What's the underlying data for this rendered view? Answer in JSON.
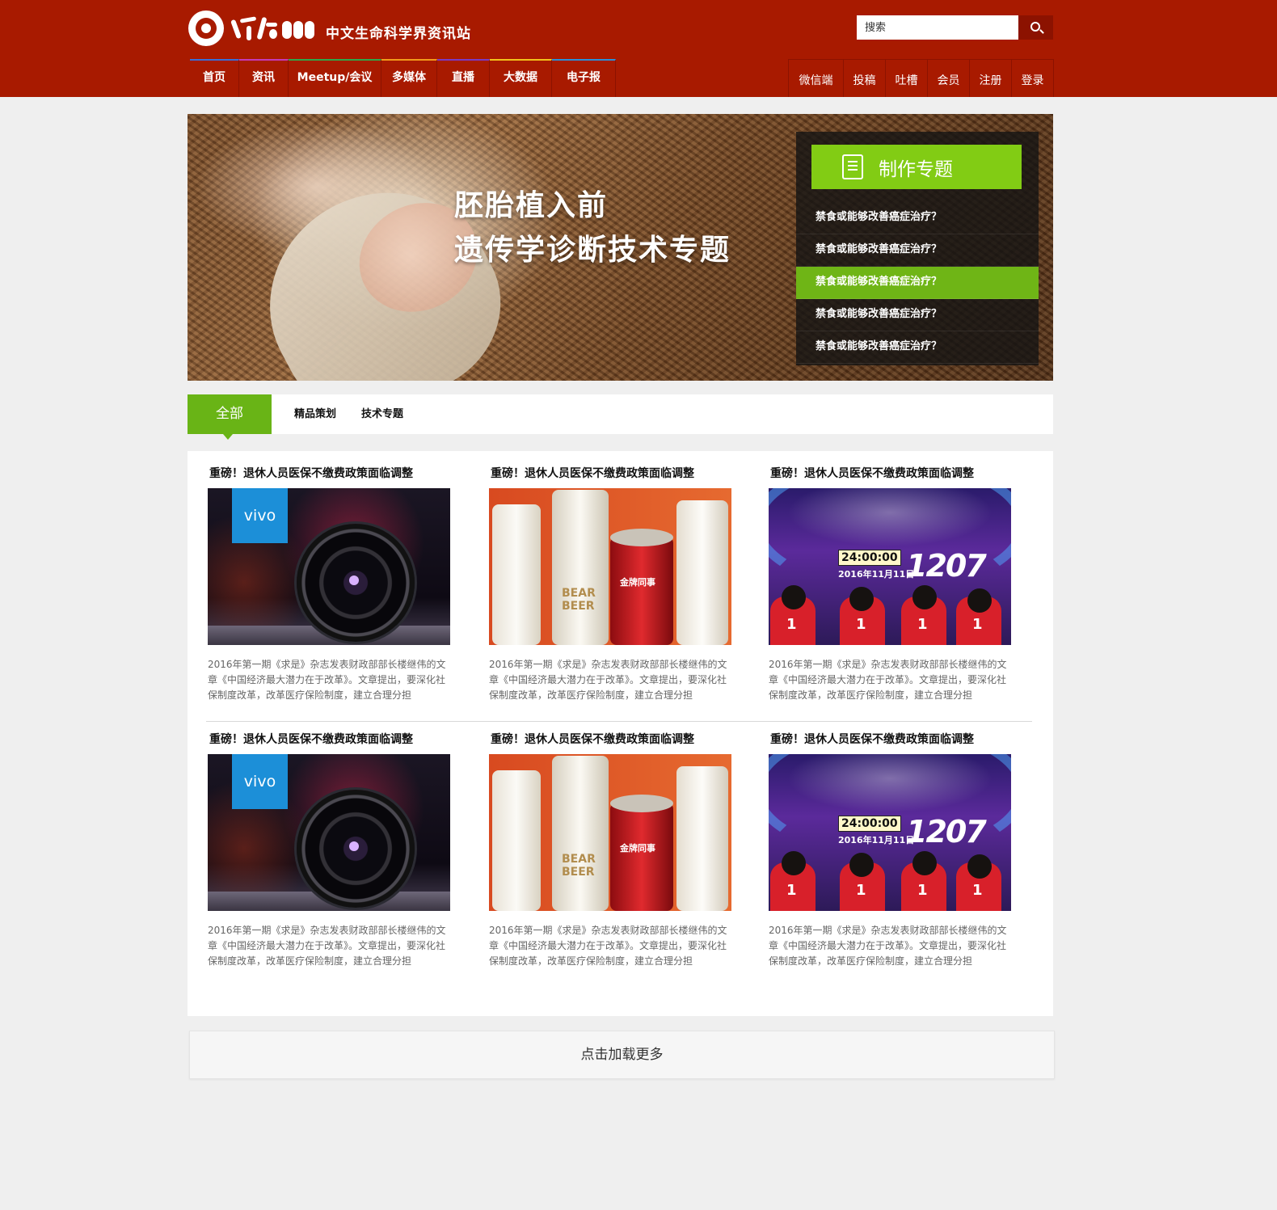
{
  "header": {
    "site_tagline": "中文生命科学界资讯站",
    "search": {
      "placeholder": "搜索"
    },
    "nav": [
      {
        "label": "首页",
        "accent": "#3a6fd8"
      },
      {
        "label": "资讯",
        "accent": "#c43ab8"
      },
      {
        "label": "Meetup/会议",
        "accent": "#2fa84a"
      },
      {
        "label": "多媒体",
        "accent": "#f29b1b"
      },
      {
        "label": "直播",
        "accent": "#7b3ac4"
      },
      {
        "label": "大数据",
        "accent": "#f2c21b"
      },
      {
        "label": "电子报",
        "accent": "#2b8fd8"
      }
    ],
    "subnav": [
      "微信端",
      "投稿",
      "吐槽",
      "会员",
      "注册",
      "登录"
    ]
  },
  "banner": {
    "title_line1": "胚胎植入前",
    "title_line2": "遗传学诊断技术专题",
    "panel_heading": "制作专题",
    "topics": [
      "禁食或能够改善癌症治疗？",
      "禁食或能够改善癌症治疗？",
      "禁食或能够改善癌症治疗？",
      "禁食或能够改善癌症治疗？",
      "禁食或能够改善癌症治疗？"
    ],
    "active_topic_index": 2
  },
  "tabs": [
    "全部",
    "精品策划",
    "技术专题"
  ],
  "images": {
    "camera": {
      "badge": "vivo"
    },
    "bottles": {
      "beer_line1": "BEAR",
      "beer_line2": "BEER",
      "can_text": "金牌同事"
    },
    "stage": {
      "timer": "24:00:00",
      "date": "2016年11月11日",
      "figure": "1207"
    }
  },
  "articles": [
    {
      "title": "重磅！退休人员医保不缴费政策面临调整",
      "image": "camera",
      "desc": "2016年第一期《求是》杂志发表财政部部长楼继伟的文章《中国经济最大潜力在于改革》。文章提出，要深化社保制度改革，改革医疗保险制度，建立合理分担"
    },
    {
      "title": "重磅！退休人员医保不缴费政策面临调整",
      "image": "bottles",
      "desc": "2016年第一期《求是》杂志发表财政部部长楼继伟的文章《中国经济最大潜力在于改革》。文章提出，要深化社保制度改革，改革医疗保险制度，建立合理分担"
    },
    {
      "title": "重磅！退休人员医保不缴费政策面临调整",
      "image": "stage",
      "desc": "2016年第一期《求是》杂志发表财政部部长楼继伟的文章《中国经济最大潜力在于改革》。文章提出，要深化社保制度改革，改革医疗保险制度，建立合理分担"
    },
    {
      "title": "重磅！退休人员医保不缴费政策面临调整",
      "image": "camera",
      "desc": "2016年第一期《求是》杂志发表财政部部长楼继伟的文章《中国经济最大潜力在于改革》。文章提出，要深化社保制度改革，改革医疗保险制度，建立合理分担"
    },
    {
      "title": "重磅！退休人员医保不缴费政策面临调整",
      "image": "bottles",
      "desc": "2016年第一期《求是》杂志发表财政部部长楼继伟的文章《中国经济最大潜力在于改革》。文章提出，要深化社保制度改革，改革医疗保险制度，建立合理分担"
    },
    {
      "title": "重磅！退休人员医保不缴费政策面临调整",
      "image": "stage",
      "desc": "2016年第一期《求是》杂志发表财政部部长楼继伟的文章《中国经济最大潜力在于改革》。文章提出，要深化社保制度改革，改革医疗保险制度，建立合理分担"
    }
  ],
  "load_more": "点击加载更多",
  "colors": {
    "brand_red": "#a81a00",
    "accent_green": "#69b416",
    "page_bg": "#efefef"
  }
}
